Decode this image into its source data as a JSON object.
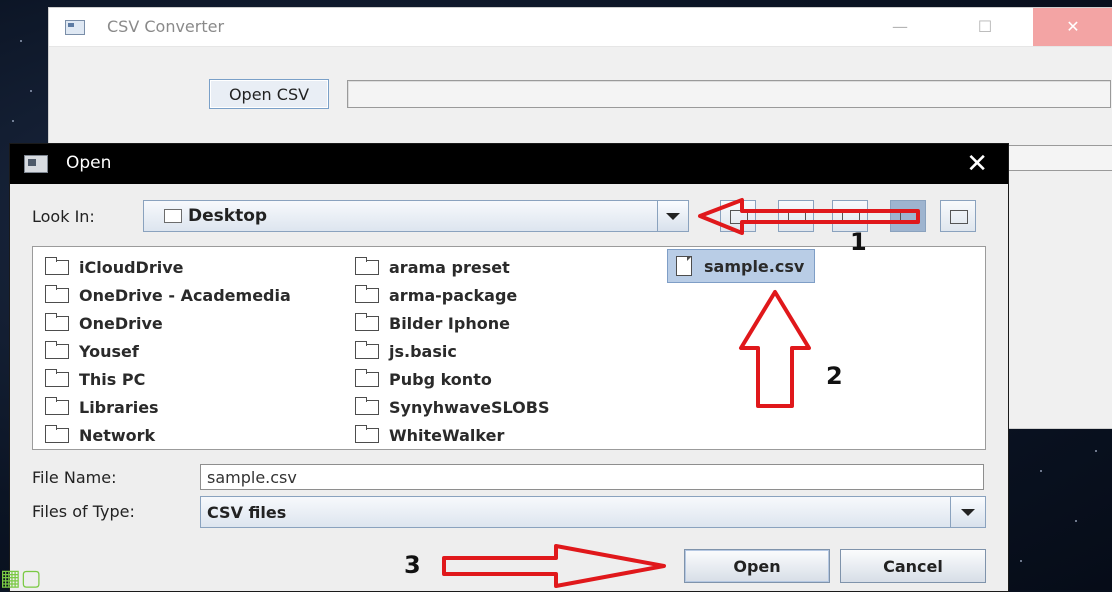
{
  "main_window": {
    "title": "CSV Converter",
    "open_csv_label": "Open CSV"
  },
  "dialog": {
    "title": "Open",
    "look_in_label": "Look In:",
    "look_in_value": "Desktop",
    "files_col1": [
      "iCloudDrive",
      "OneDrive - Academedia",
      "OneDrive",
      "Yousef",
      "This PC",
      "Libraries",
      "Network"
    ],
    "files_col2": [
      "arama preset",
      "arma-package",
      "Bilder Iphone",
      "js.basic",
      "Pubg konto",
      "SynyhwaveSLOBS",
      "WhiteWalker"
    ],
    "selected_file": "sample.csv",
    "file_name_label": "File Name:",
    "file_name_value": "sample.csv",
    "files_of_type_label": "Files of Type:",
    "files_of_type_value": "CSV files",
    "open_button": "Open",
    "cancel_button": "Cancel"
  },
  "annotations": {
    "step1": "1",
    "step2": "2",
    "step3": "3",
    "arrow_color": "#e0181b"
  }
}
